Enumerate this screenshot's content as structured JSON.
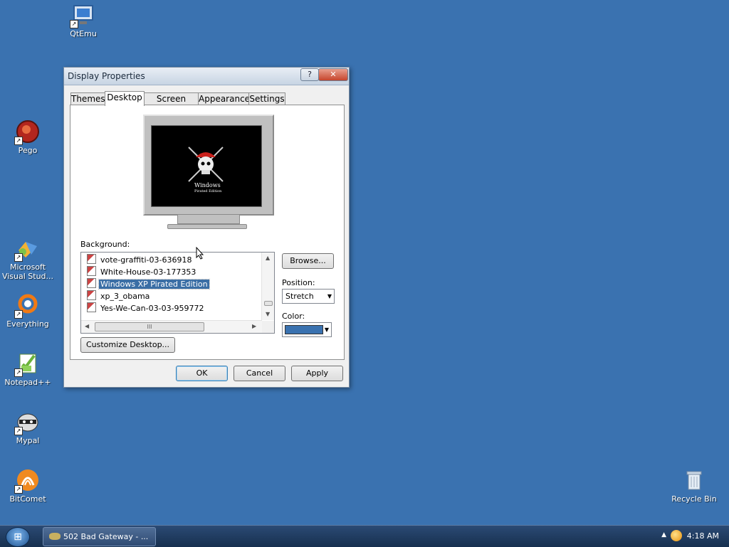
{
  "desktop": {
    "icons": [
      {
        "label": "QtEmu"
      },
      {
        "label": "Pego"
      },
      {
        "label": "Microsoft Visual Stud..."
      },
      {
        "label": "Everything"
      },
      {
        "label": "Notepad++"
      },
      {
        "label": "Mypal"
      },
      {
        "label": "BitComet"
      },
      {
        "label": "Recycle Bin"
      }
    ]
  },
  "dialog": {
    "title": "Display Properties",
    "help_glyph": "?",
    "close_glyph": "✕",
    "tabs": [
      {
        "label": "Themes"
      },
      {
        "label": "Desktop",
        "active": true
      },
      {
        "label": "Screen Saver"
      },
      {
        "label": "Appearance"
      },
      {
        "label": "Settings"
      }
    ],
    "preview": {
      "brand_line1": "Windows",
      "brand_line2": "Pirated Edition"
    },
    "background_label": "Background:",
    "backgrounds": [
      {
        "name": "vote-graffiti-03-636918"
      },
      {
        "name": "White-House-03-177353"
      },
      {
        "name": "Windows XP Pirated Edition",
        "selected": true
      },
      {
        "name": "xp_3_obama"
      },
      {
        "name": "Yes-We-Can-03-03-959772"
      }
    ],
    "hscroll_grip": "III",
    "browse_button": "Browse...",
    "position_label": "Position:",
    "position_value": "Stretch",
    "color_label": "Color:",
    "color_value": "#3a72b0",
    "customize_button": "Customize Desktop...",
    "ok_button": "OK",
    "cancel_button": "Cancel",
    "apply_button": "Apply"
  },
  "taskbar": {
    "task_label": "502 Bad Gateway - ...",
    "clock": "4:18 AM"
  }
}
